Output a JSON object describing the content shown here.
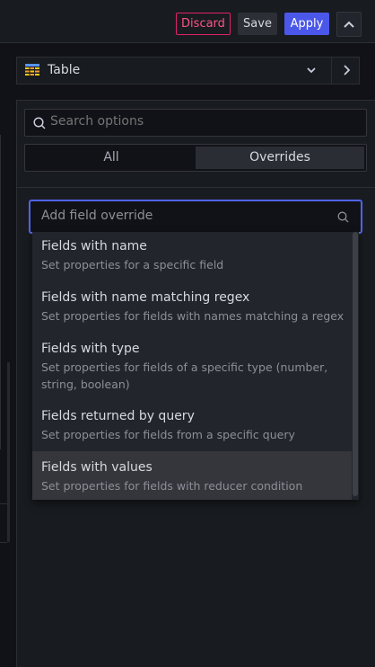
{
  "topbar": {
    "discard_label": "Discard",
    "save_label": "Save",
    "apply_label": "Apply"
  },
  "viz_picker": {
    "label": "Table",
    "icon": "table-icon"
  },
  "search": {
    "placeholder": "Search options"
  },
  "tabs": [
    {
      "label": "All",
      "active": false
    },
    {
      "label": "Overrides",
      "active": true
    }
  ],
  "override": {
    "placeholder": "Add field override"
  },
  "options": [
    {
      "title": "Fields with name",
      "desc": "Set properties for a specific field"
    },
    {
      "title": "Fields with name matching regex",
      "desc": "Set properties for fields with names matching a regex"
    },
    {
      "title": "Fields with type",
      "desc": "Set properties for fields of a specific type (number, string, boolean)"
    },
    {
      "title": "Fields returned by query",
      "desc": "Set properties for fields from a specific query"
    },
    {
      "title": "Fields with values",
      "desc": "Set properties for fields with reducer condition"
    }
  ],
  "colors": {
    "accent": "#4b57e8",
    "discard": "#e0226e",
    "focus": "#4f64e8"
  }
}
